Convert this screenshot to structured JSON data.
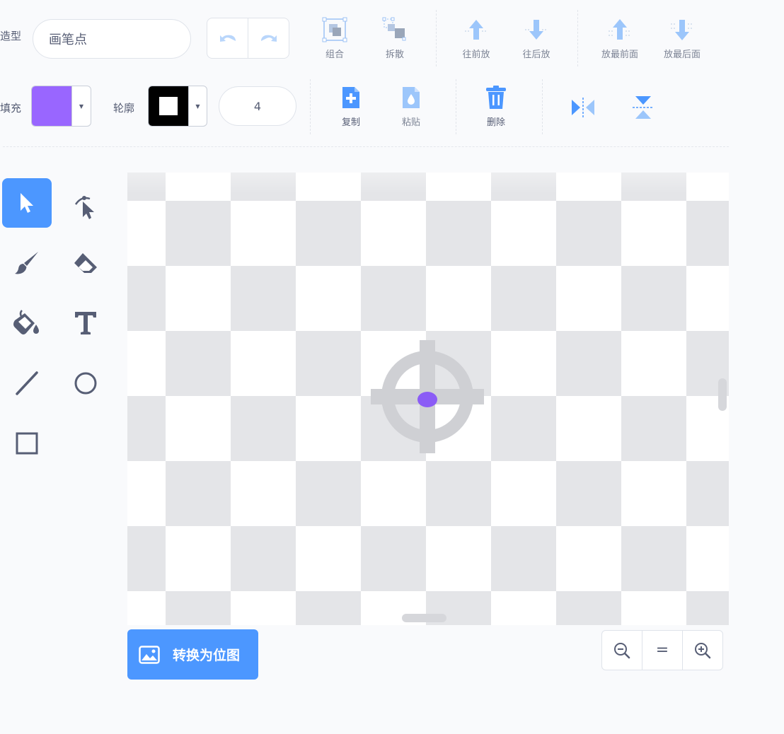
{
  "colors": {
    "accent": "#4c97ff",
    "fill": "#9966ff",
    "outline": "#000000",
    "canvas_check": "#e4e5e8"
  },
  "costume": {
    "label": "造型",
    "name": "画笔点"
  },
  "history": {
    "undo_icon": "undo-icon",
    "redo_icon": "redo-icon"
  },
  "arrange": {
    "group": "组合",
    "ungroup": "拆散",
    "forward": "往前放",
    "backward": "往后放",
    "front": "放最前面",
    "back": "放最后面"
  },
  "style": {
    "fill_label": "填充",
    "outline_label": "轮廓",
    "stroke_width": "4"
  },
  "edit": {
    "copy": "复制",
    "paste": "粘贴",
    "delete": "删除"
  },
  "tools": [
    "select",
    "reshape",
    "brush",
    "eraser",
    "fill",
    "text",
    "line",
    "circle",
    "rectangle"
  ],
  "convert_button": {
    "label": "转换为位图"
  },
  "zoom": {
    "out": "−",
    "reset": "=",
    "in": "+"
  }
}
